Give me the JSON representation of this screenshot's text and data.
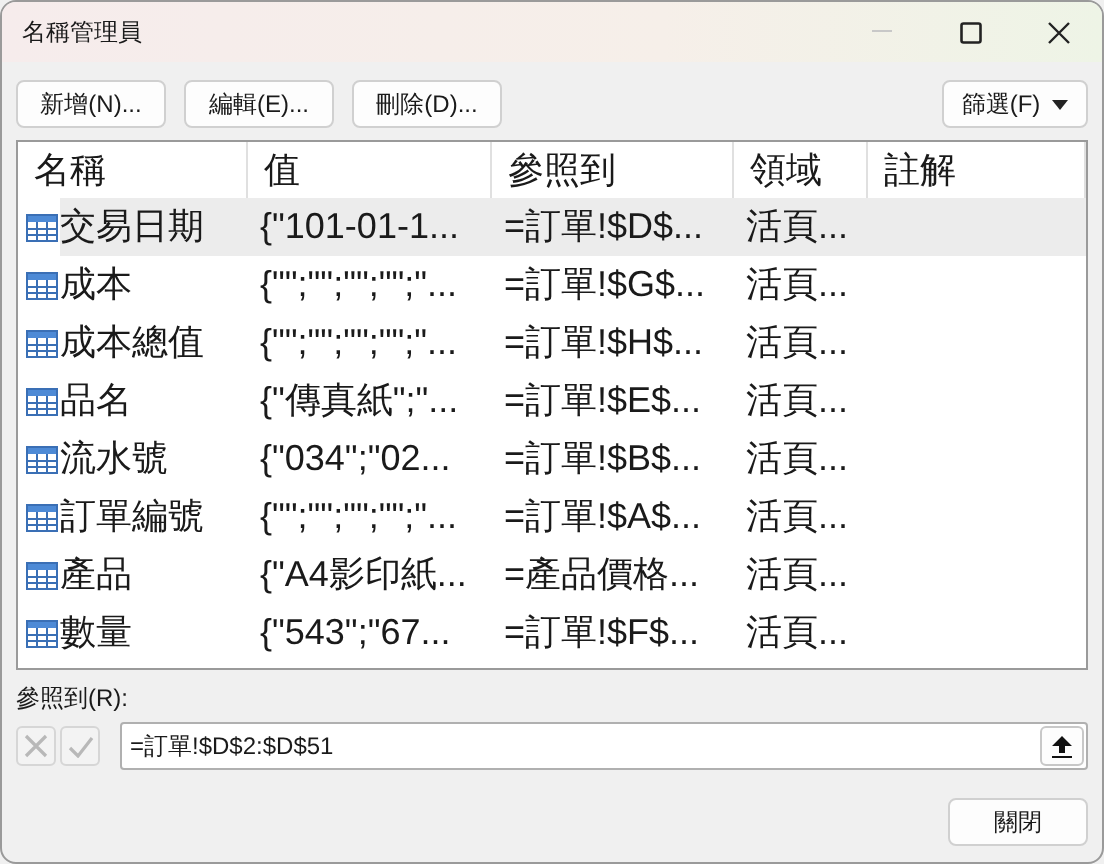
{
  "window": {
    "title": "名稱管理員"
  },
  "toolbar": {
    "buttons": [
      "新增(N)...",
      "編輯(E)...",
      "刪除(D)..."
    ],
    "filter_button": "篩選(F)"
  },
  "table": {
    "columns": [
      "名稱",
      "值",
      "參照到",
      "領域",
      "註解"
    ],
    "rows": [
      {
        "name": "交易日期",
        "value": "{\"101-01-1...",
        "refers_to": "=訂單!$D$...",
        "scope": "活頁...",
        "selected": true
      },
      {
        "name": "成本",
        "value": "{\"\";\"\";\"\";\"\";\"...",
        "refers_to": "=訂單!$G$...",
        "scope": "活頁...",
        "selected": false
      },
      {
        "name": "成本總值",
        "value": "{\"\";\"\";\"\";\"\";\"...",
        "refers_to": "=訂單!$H$...",
        "scope": "活頁...",
        "selected": false
      },
      {
        "name": "品名",
        "value": "{\"傳真紙\";\"...",
        "refers_to": "=訂單!$E$...",
        "scope": "活頁...",
        "selected": false
      },
      {
        "name": "流水號",
        "value": "{\"034\";\"02...",
        "refers_to": "=訂單!$B$...",
        "scope": "活頁...",
        "selected": false
      },
      {
        "name": "訂單編號",
        "value": "{\"\";\"\";\"\";\"\";\"...",
        "refers_to": "=訂單!$A$...",
        "scope": "活頁...",
        "selected": false
      },
      {
        "name": "產品",
        "value": "{\"A4影印紙...",
        "refers_to": "=產品價格...",
        "scope": "活頁...",
        "selected": false
      },
      {
        "name": "數量",
        "value": "{\"543\";\"67...",
        "refers_to": "=訂單!$F$...",
        "scope": "活頁...",
        "selected": false
      }
    ]
  },
  "refers_to": {
    "label": "參照到(R):",
    "value": "=訂單!$D$2:$D$51"
  },
  "close_button": "關閉"
}
